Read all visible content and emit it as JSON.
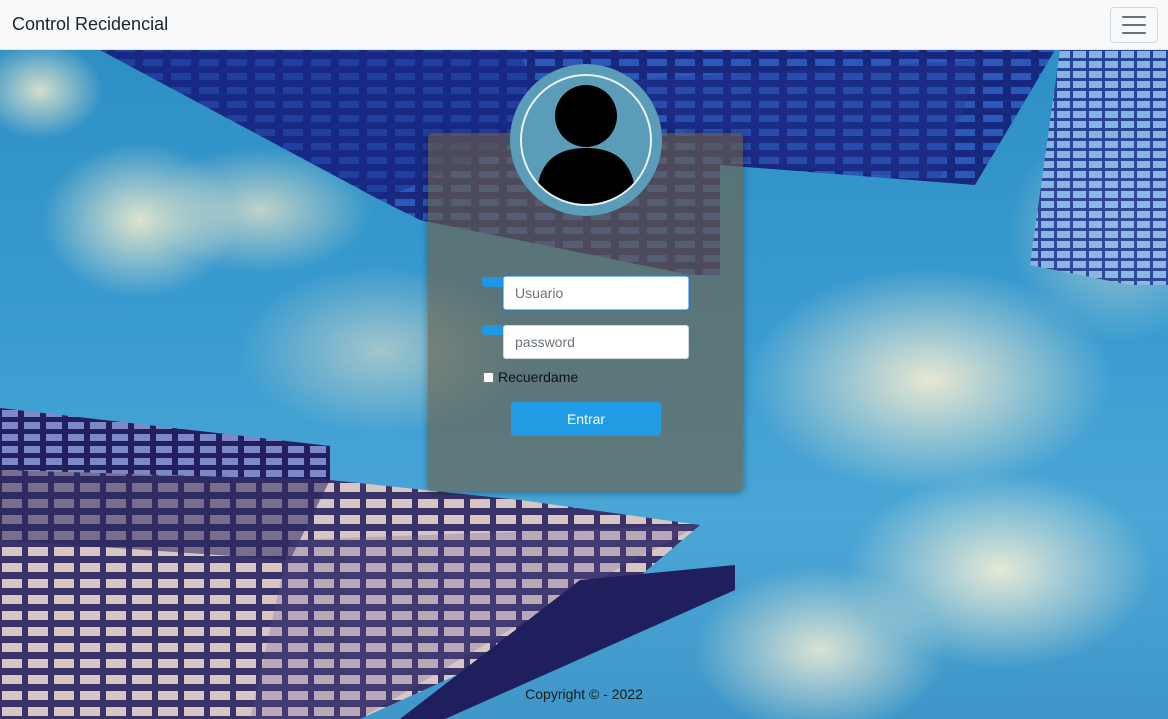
{
  "navbar": {
    "brand": "Control Recidencial",
    "toggle_icon": "hamburger-menu-icon"
  },
  "login": {
    "avatar_icon": "user-avatar-icon",
    "username_placeholder": "Usuario",
    "password_placeholder": "password",
    "remember_label": "Recuerdame",
    "remember_checked": false,
    "submit_label": "Entrar"
  },
  "footer": {
    "text": "Copyright © - 2022"
  },
  "colors": {
    "accent": "#219be4",
    "navbar_bg": "#f8f9fa",
    "avatar_bg": "#5b9cb8"
  }
}
